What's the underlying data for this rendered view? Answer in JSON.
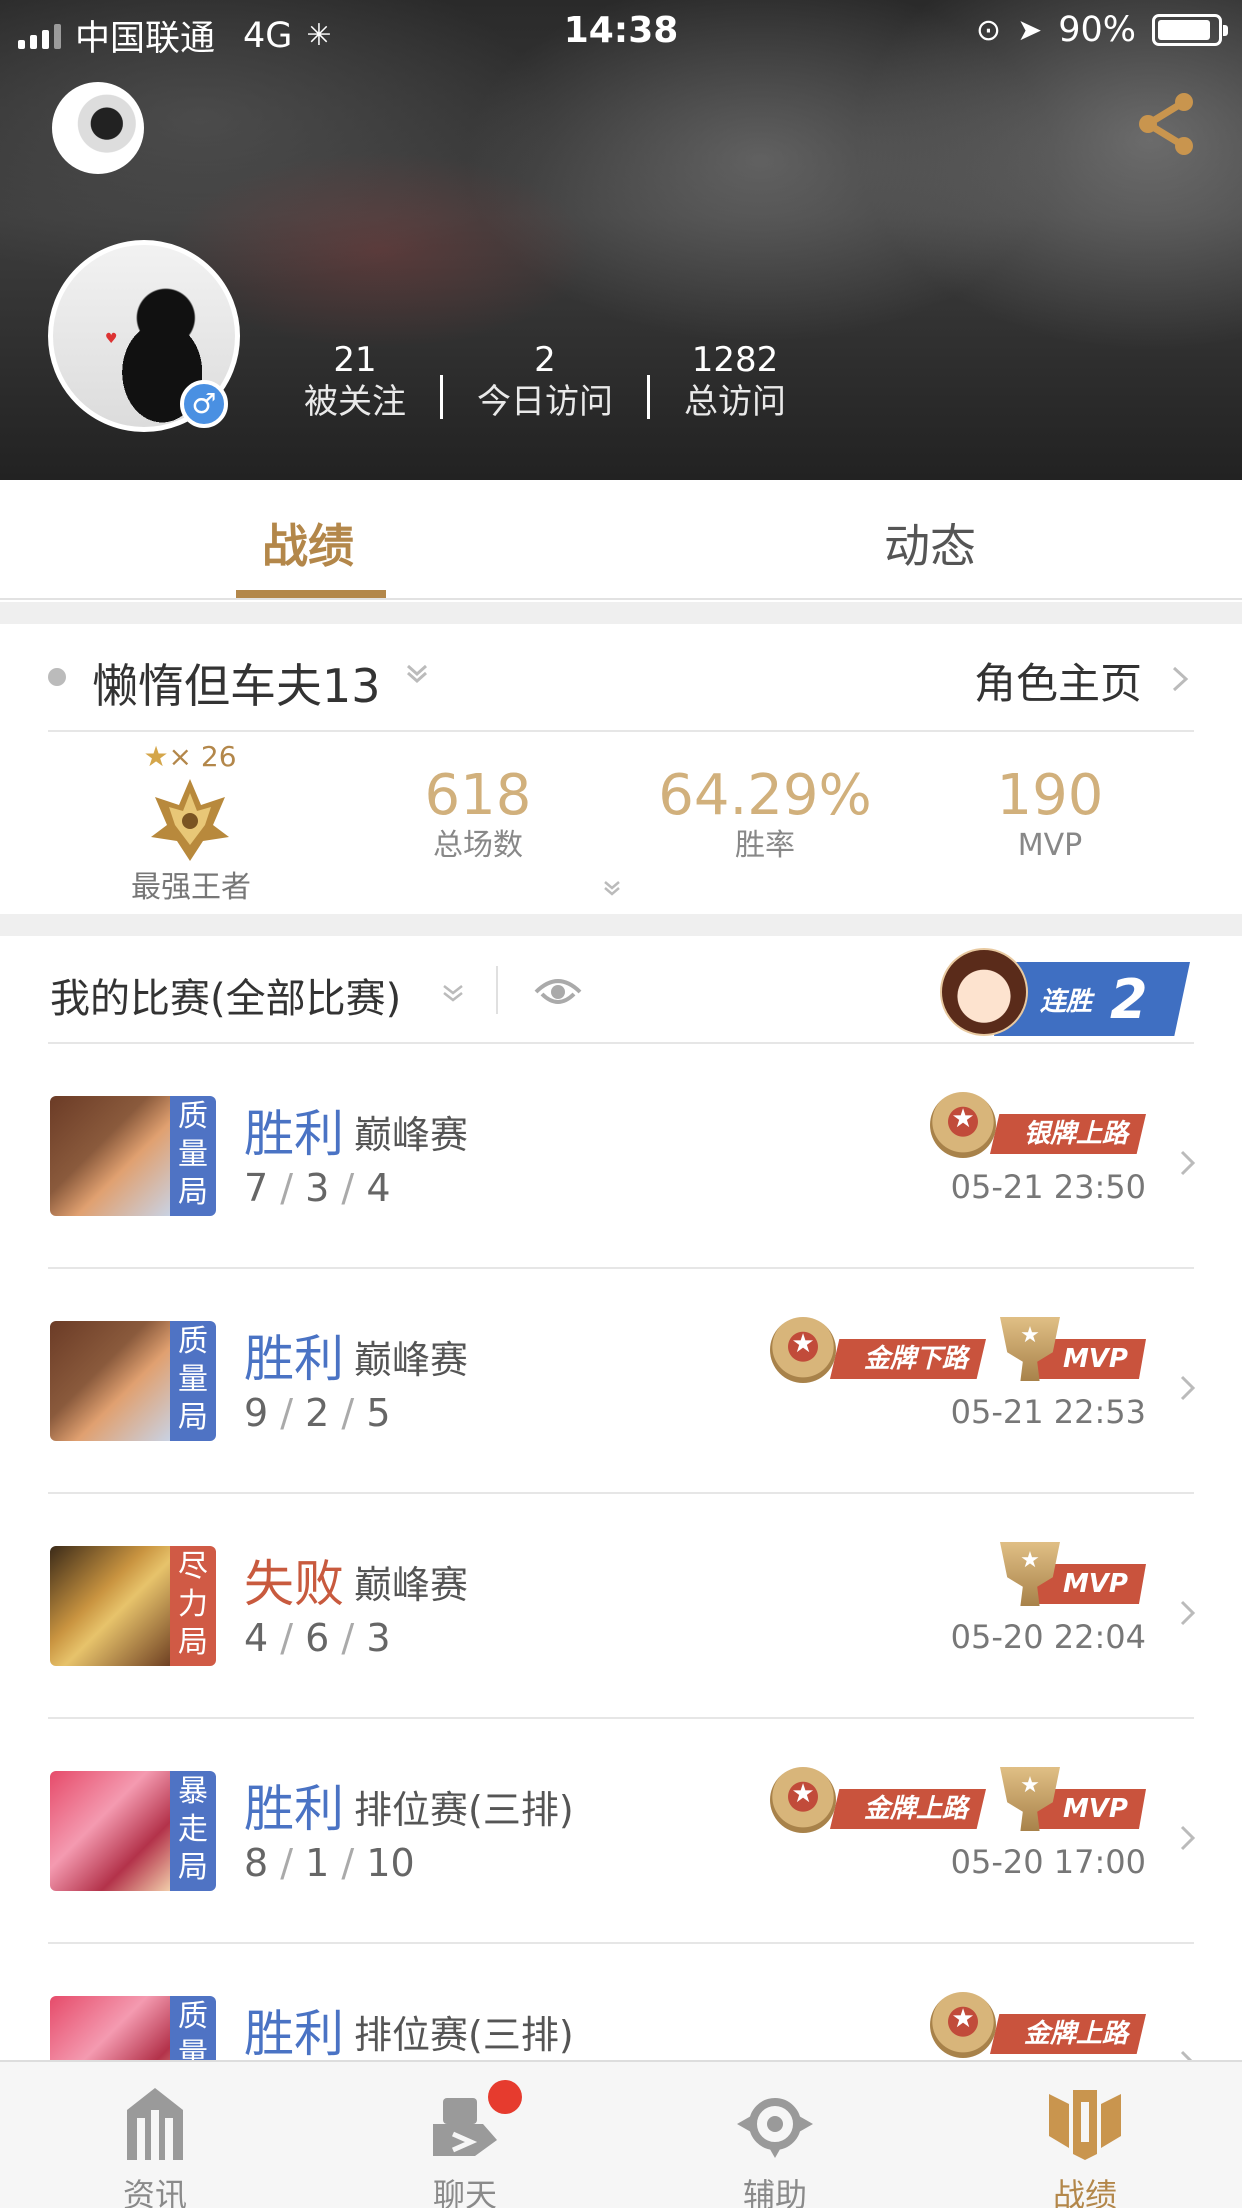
{
  "status_bar": {
    "carrier": "中国联通",
    "network": "4G",
    "time": "14:38",
    "battery": "90%"
  },
  "profile": {
    "gender": "♂",
    "stats": [
      {
        "value": "21",
        "label": "被关注"
      },
      {
        "value": "2",
        "label": "今日访问"
      },
      {
        "value": "1282",
        "label": "总访问"
      }
    ]
  },
  "tabs": {
    "record": "战绩",
    "feed": "动态"
  },
  "role": {
    "name": "懒惰但车夫13",
    "home_link": "角色主页",
    "rank_stars": "× 26",
    "rank_name": "最强王者",
    "metrics": [
      {
        "value": "618",
        "label": "总场数"
      },
      {
        "value": "64.29%",
        "label": "胜率"
      },
      {
        "value": "190",
        "label": "MVP"
      }
    ]
  },
  "matches_header": {
    "title": "我的比赛(全部比赛)",
    "streak_label": "连胜",
    "streak_count": "2"
  },
  "matches": [
    {
      "quality": "质量局",
      "result": "胜利",
      "mode": "巅峰赛",
      "k": "7",
      "d": "3",
      "a": "4",
      "time": "05-21 23:50",
      "route_badge": "银牌上路",
      "mvp": ""
    },
    {
      "quality": "质量局",
      "result": "胜利",
      "mode": "巅峰赛",
      "k": "9",
      "d": "2",
      "a": "5",
      "time": "05-21 22:53",
      "route_badge": "金牌下路",
      "mvp": "MVP"
    },
    {
      "quality": "尽力局",
      "result": "失败",
      "mode": "巅峰赛",
      "k": "4",
      "d": "6",
      "a": "3",
      "time": "05-20 22:04",
      "route_badge": "",
      "mvp": "MVP"
    },
    {
      "quality": "暴走局",
      "result": "胜利",
      "mode": "排位赛(三排)",
      "k": "8",
      "d": "1",
      "a": "10",
      "time": "05-20 17:00",
      "route_badge": "金牌上路",
      "mvp": "MVP"
    },
    {
      "quality": "质量局",
      "result": "胜利",
      "mode": "排位赛(三排)",
      "k": "",
      "d": "",
      "a": "",
      "time": "",
      "route_badge": "金牌上路",
      "mvp": ""
    }
  ],
  "bottom_nav": [
    {
      "label": "资讯",
      "icon": "news-icon"
    },
    {
      "label": "聊天",
      "icon": "chat-icon"
    },
    {
      "label": "辅助",
      "icon": "assist-icon"
    },
    {
      "label": "战绩",
      "icon": "record-icon"
    }
  ],
  "colors": {
    "accent_gold": "#b3874a",
    "win_blue": "#4a73c4",
    "lose_red": "#c85a3e"
  }
}
